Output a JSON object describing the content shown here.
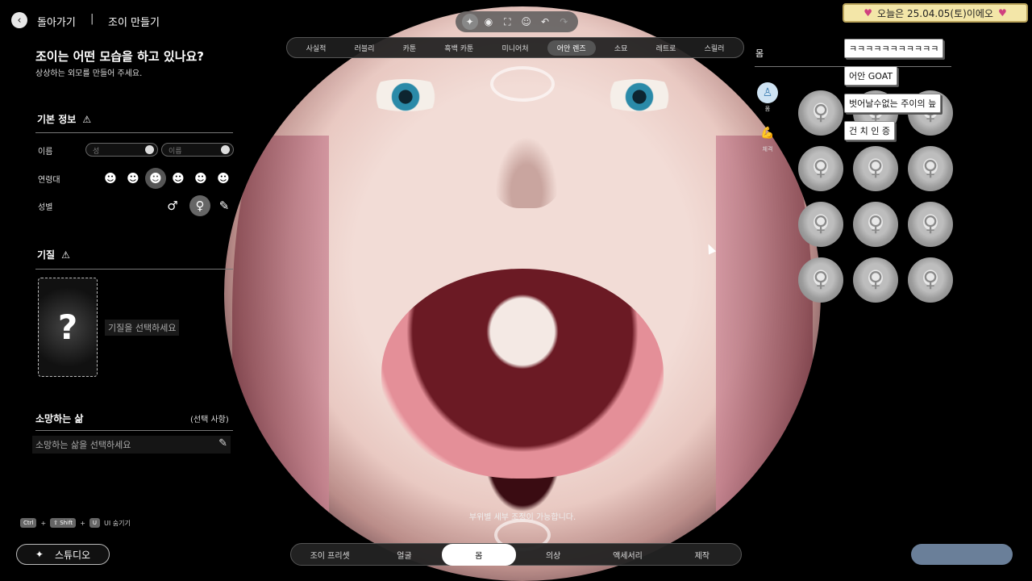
{
  "header": {
    "back_label": "돌아가기",
    "separator": "|",
    "page_title": "조이 만들기"
  },
  "left": {
    "question": "조이는 어떤 모습을 하고 있나요?",
    "subtitle": "상상하는 외모를 만들어 주세요.",
    "basic_info": {
      "title": "기본 정보",
      "name_label": "이름",
      "surname_placeholder": "성",
      "name_placeholder": "이름",
      "age_label": "연령대",
      "gender_label": "성별",
      "male_symbol": "♂",
      "female_symbol": "♀"
    },
    "temperament": {
      "title": "기질",
      "card_symbol": "?",
      "hint": "기질을 선택하세요"
    },
    "wish": {
      "title": "소망하는 삶",
      "optional": "(선택 사항)",
      "placeholder": "소망하는 삶을 선택하세요"
    },
    "shortcut": {
      "key1": "Ctrl",
      "plus": "+",
      "key2": "⇧ Shift",
      "key3": "U",
      "label": "UI 숨기기"
    },
    "studio_label": "스튜디오"
  },
  "style_tabs": [
    "사실적",
    "러블리",
    "카툰",
    "흑백 카툰",
    "미니어처",
    "어안 렌즈",
    "소묘",
    "레트로",
    "스릴러"
  ],
  "style_selected": 5,
  "viewport": {
    "hint": "부위별 세부 조정이 가능합니다."
  },
  "right": {
    "title": "몸",
    "side_tabs": [
      {
        "label": "몸",
        "icon": "body-icon"
      },
      {
        "label": "체격",
        "icon": "arm-icon"
      }
    ]
  },
  "bottom_tabs": [
    "조이 프리셋",
    "얼굴",
    "몸",
    "의상",
    "액세서리",
    "제작"
  ],
  "bottom_selected": 2,
  "chat": {
    "banner": "오늘은 25.04.05(토)이에오",
    "messages": [
      "ㅋㅋㅋㅋㅋㅋㅋㅋㅋㅋㅋ",
      "어안 GOAT",
      "벗어날수없는 주이의 늪",
      "건 치 인 증"
    ]
  },
  "colors": {
    "accent_selected": "#ffffff",
    "make_button": "#6a7f99",
    "banner_bg": "#f3e6a8"
  }
}
